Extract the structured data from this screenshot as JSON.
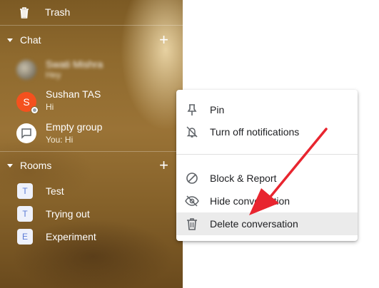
{
  "sidebar": {
    "trash_label": "Trash",
    "chat_section": {
      "title": "Chat",
      "add_label": "+"
    },
    "chats": [
      {
        "name": "Swati Mishra",
        "subtitle": "Hey",
        "blurred": true
      },
      {
        "name": "Sushan TAS",
        "subtitle": "Hi",
        "avatar_letter": "S",
        "avatar_color": "#f4511e"
      },
      {
        "name": "Empty group",
        "subtitle": "You: Hi"
      }
    ],
    "rooms_section": {
      "title": "Rooms",
      "add_label": "+"
    },
    "rooms": [
      {
        "letter": "T",
        "name": "Test"
      },
      {
        "letter": "T",
        "name": "Trying out"
      },
      {
        "letter": "E",
        "name": "Experiment"
      }
    ]
  },
  "context_menu": {
    "items": [
      {
        "label": "Pin",
        "icon": "pin-icon"
      },
      {
        "label": "Turn off notifications",
        "icon": "bell-off-icon"
      },
      {
        "label": "Block & Report",
        "icon": "block-icon"
      },
      {
        "label": "Hide conversation",
        "icon": "eye-off-icon"
      },
      {
        "label": "Delete conversation",
        "icon": "trash-icon",
        "highlighted": true
      }
    ]
  },
  "colors": {
    "accent_arrow": "#e8252f",
    "menu_highlight": "#ebebeb",
    "room_tile_text": "#5b7bd6"
  }
}
